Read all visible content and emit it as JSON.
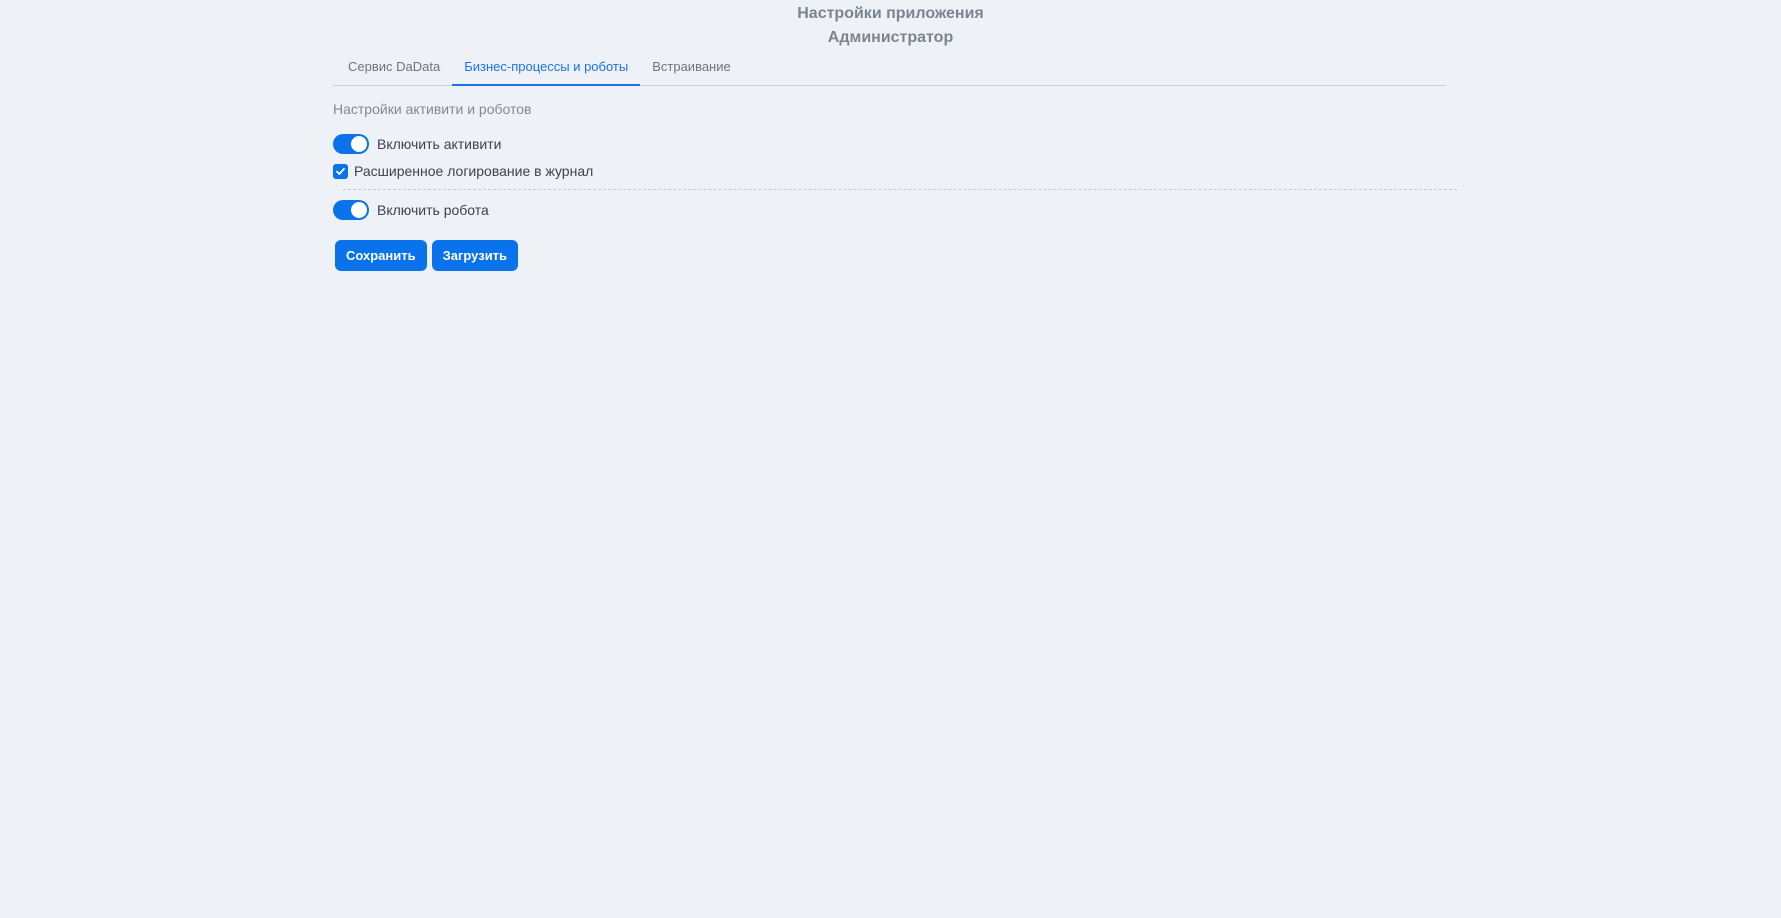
{
  "header": {
    "title": "Настройки приложения",
    "subtitle": "Администратор"
  },
  "tabs": [
    {
      "label": "Сервис DaData",
      "active": false
    },
    {
      "label": "Бизнес-процессы и роботы",
      "active": true
    },
    {
      "label": "Встраивание",
      "active": false
    }
  ],
  "settings": {
    "section_title": "Настройки активити и роботов",
    "enable_activity": {
      "label": "Включить активити",
      "checked": true
    },
    "extended_logging": {
      "label": "Расширенное логирование в журнал",
      "checked": true
    },
    "enable_robot": {
      "label": "Включить робота",
      "checked": true
    }
  },
  "actions": {
    "save_label": "Сохранить",
    "load_label": "Загрузить"
  },
  "colors": {
    "accent": "#0a72ea",
    "background": "#eef2f6"
  }
}
